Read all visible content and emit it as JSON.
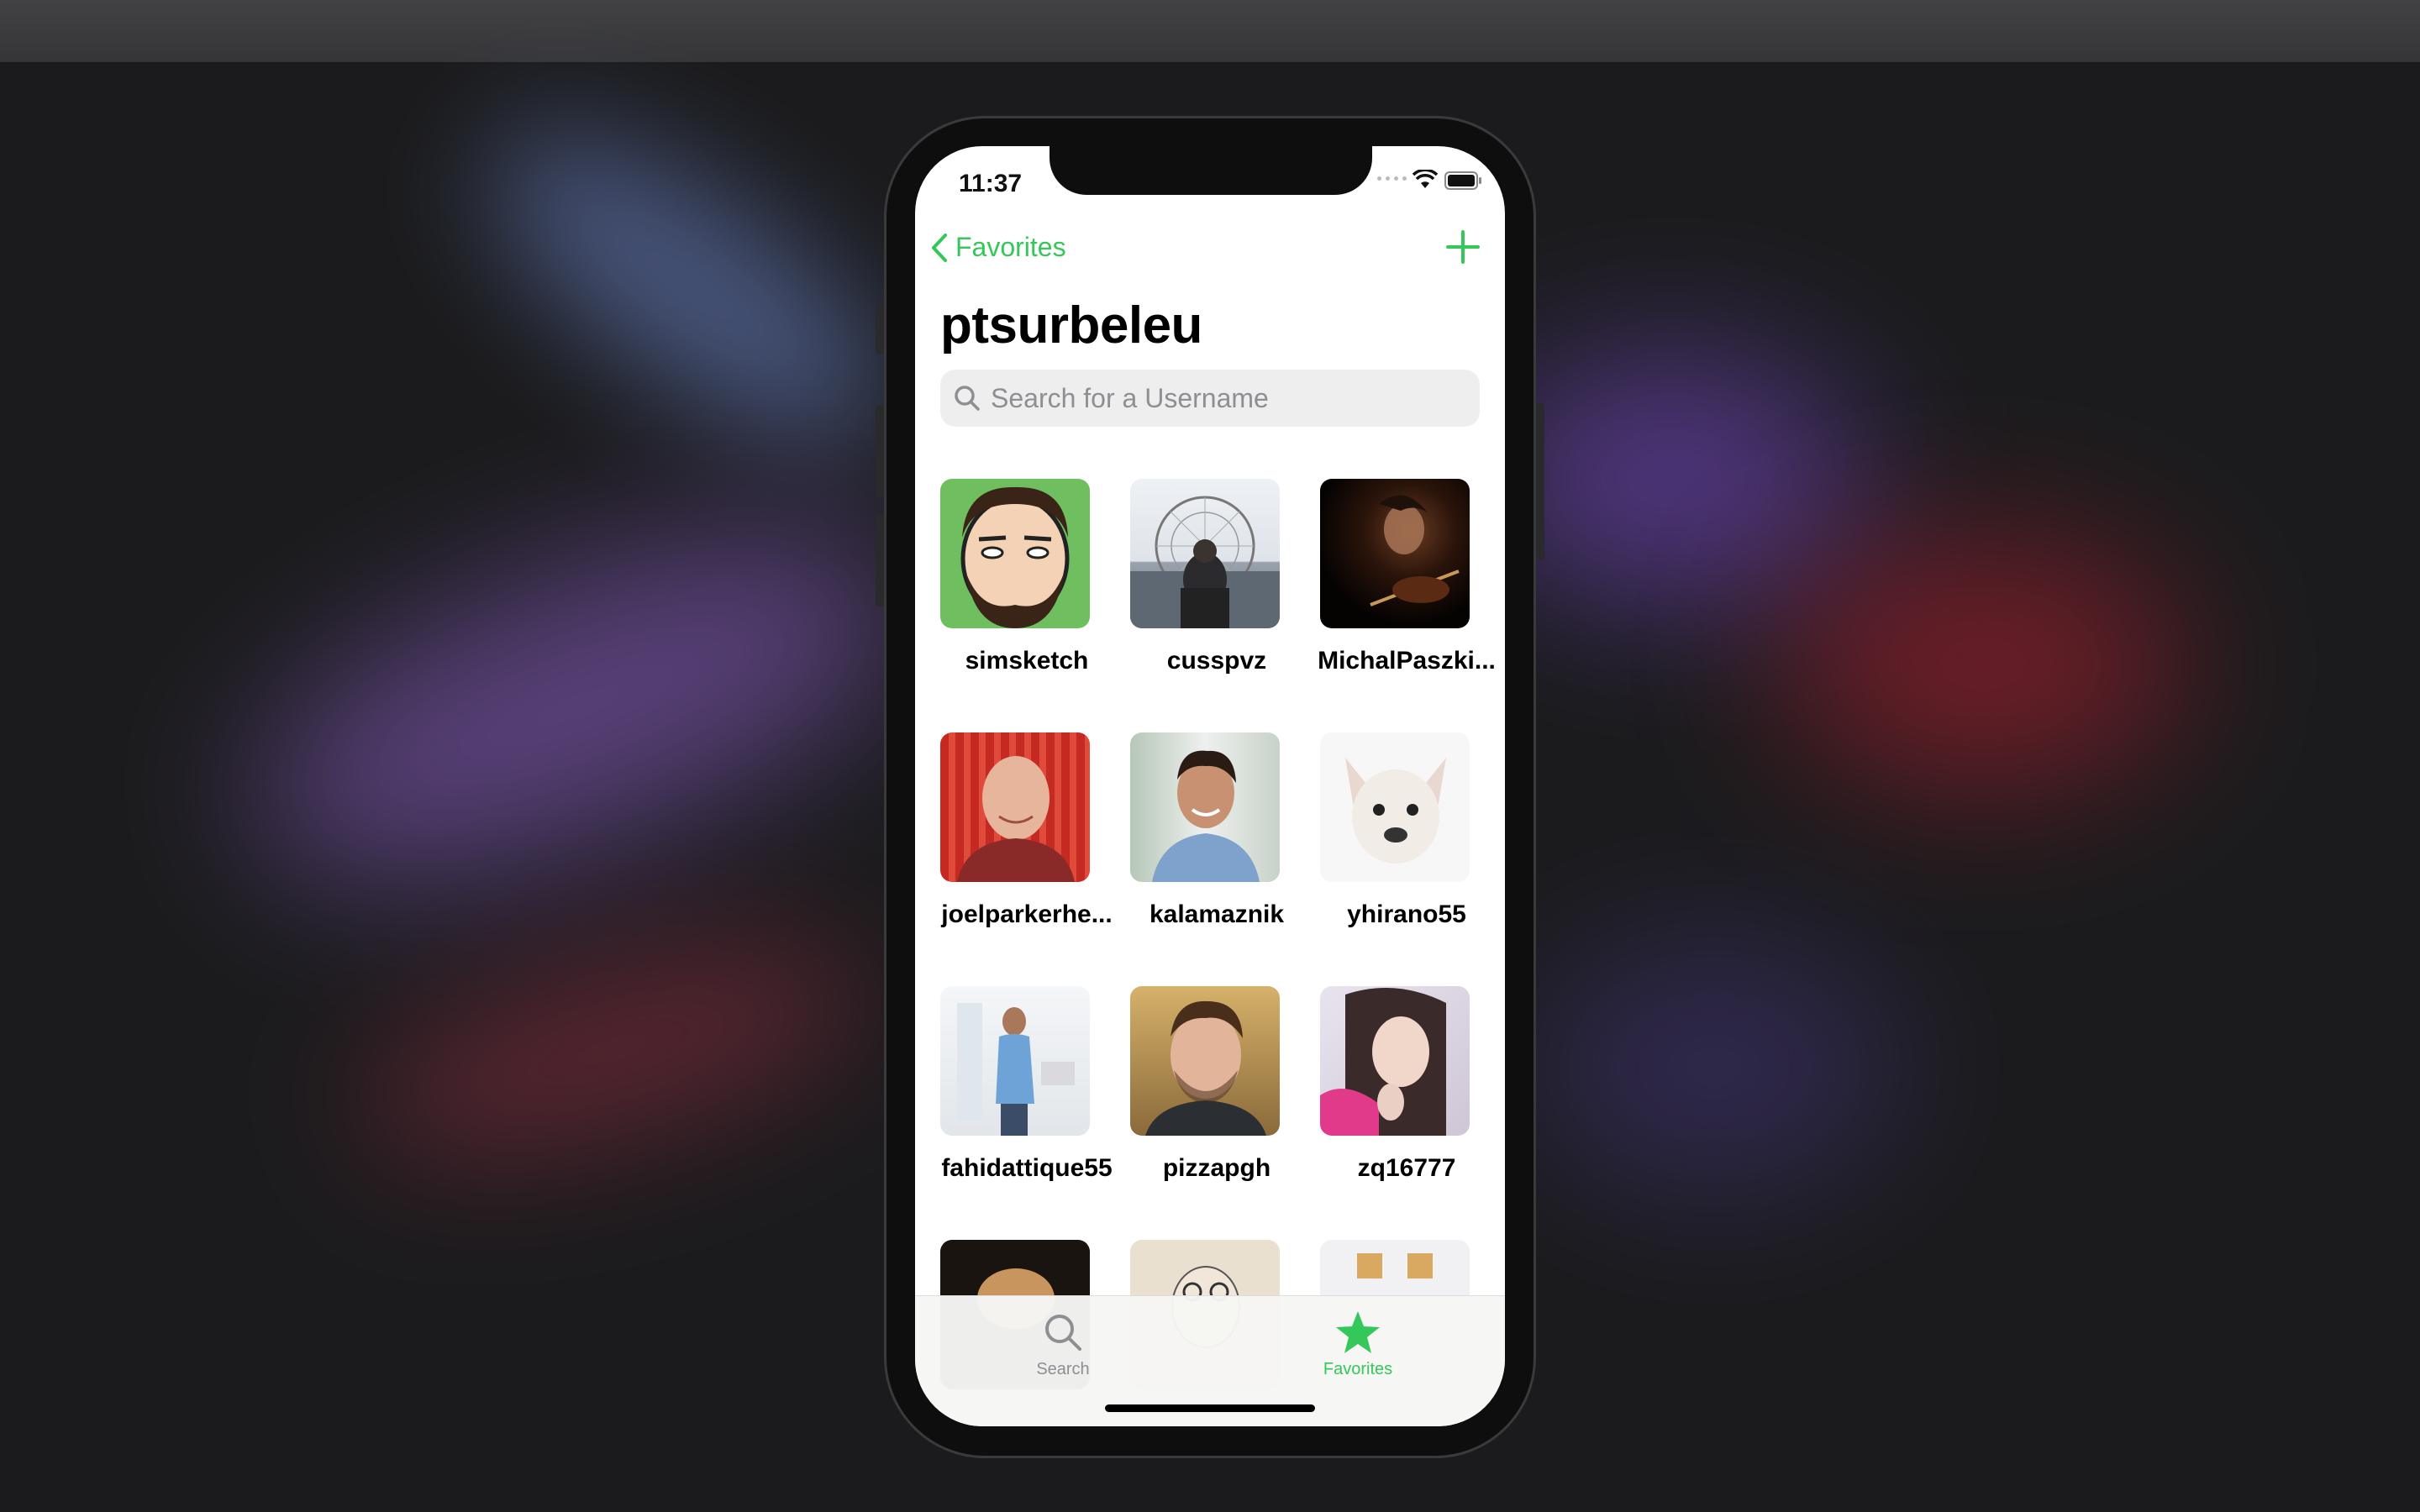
{
  "status_bar": {
    "time": "11:37"
  },
  "nav": {
    "back_label": "Favorites"
  },
  "profile": {
    "title": "ptsurbeleu"
  },
  "search": {
    "placeholder": "Search for a Username"
  },
  "followers": [
    {
      "username": "simsketch"
    },
    {
      "username": "cusspvz"
    },
    {
      "username": "MichalPaszki..."
    },
    {
      "username": "joelparkerhe..."
    },
    {
      "username": "kalamaznik"
    },
    {
      "username": "yhirano55"
    },
    {
      "username": "fahidattique55"
    },
    {
      "username": "pizzapgh"
    },
    {
      "username": "zq16777"
    }
  ],
  "tab_bar": {
    "search_label": "Search",
    "favorites_label": "Favorites"
  },
  "colors": {
    "accent": "#34c759",
    "inactive": "#8e8e93"
  }
}
